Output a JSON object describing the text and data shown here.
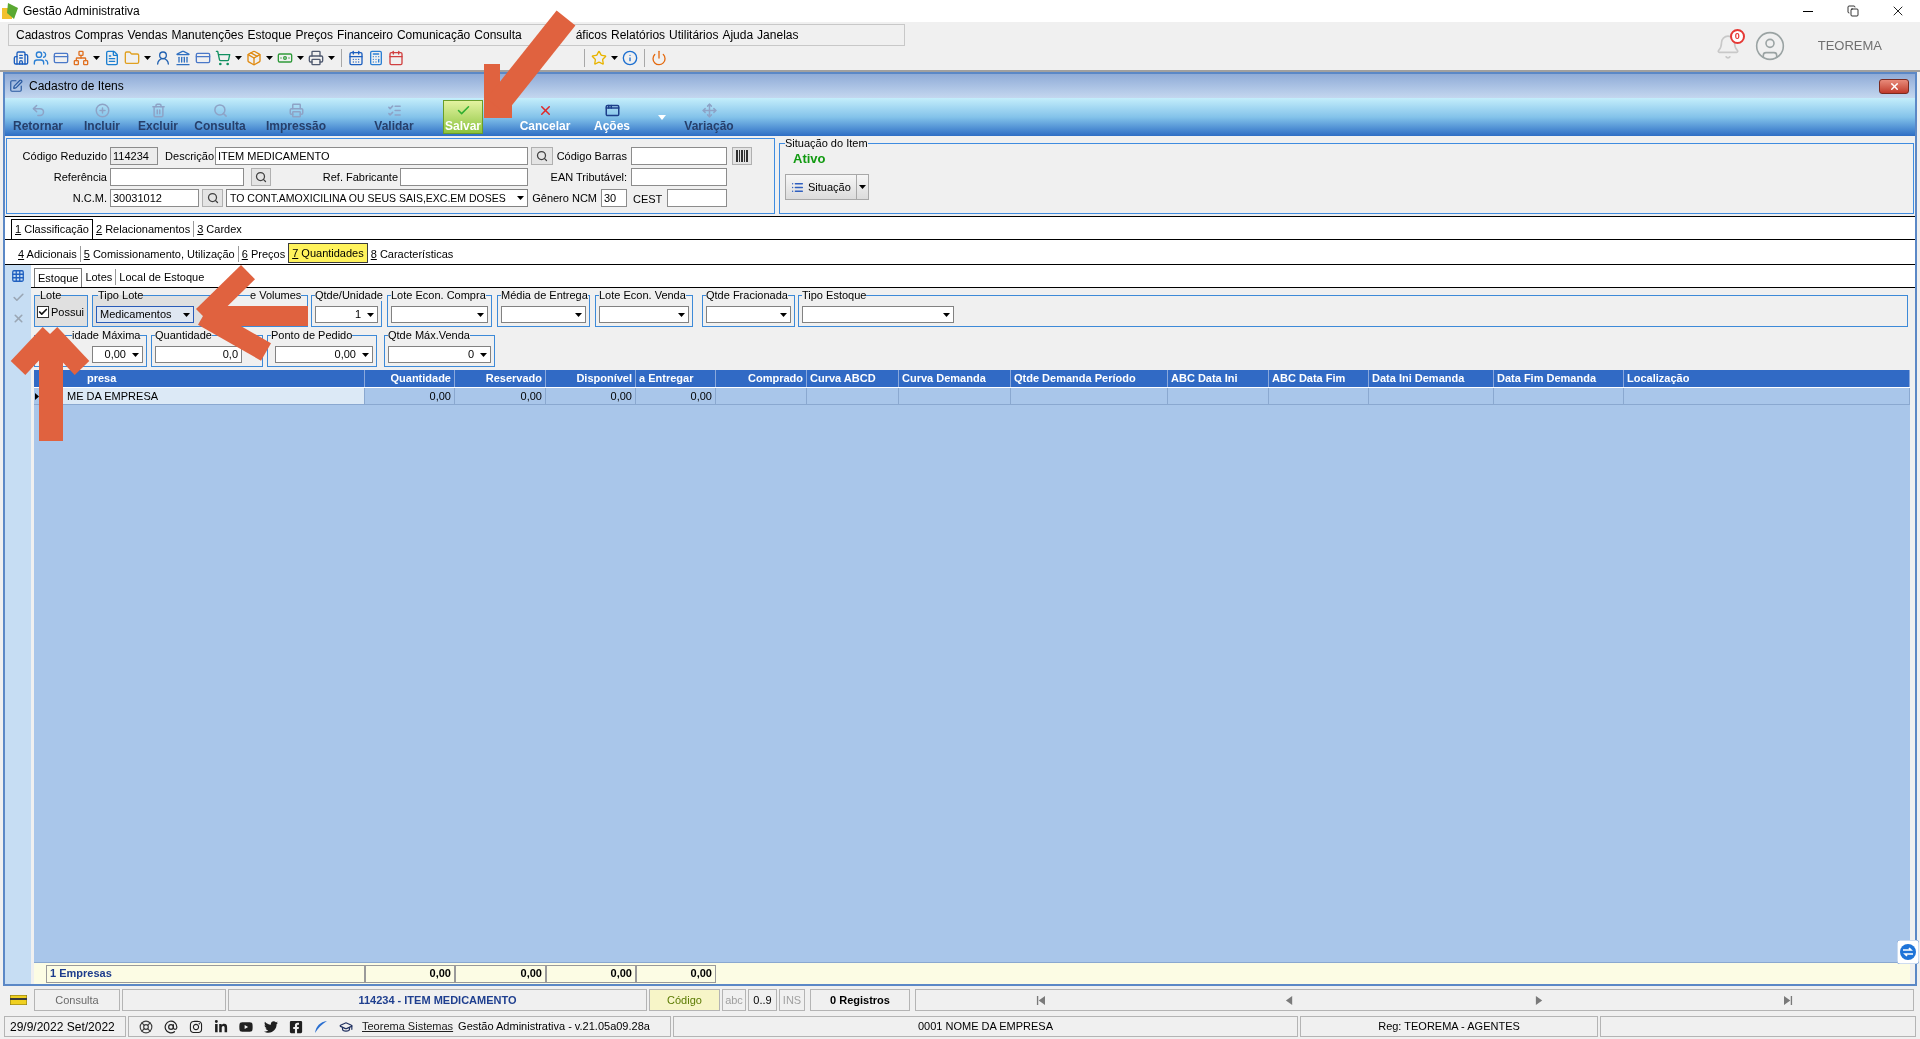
{
  "window": {
    "title": "Gestão Administrativa"
  },
  "menu": [
    "Cadastros",
    "Compras",
    "Vendas",
    "Manutenções",
    "Estoque",
    "Preços",
    "Financeiro",
    "Comunicação",
    "Consulta",
    "áficos",
    "Relatórios",
    "Utilitários",
    "Ajuda",
    "Janelas"
  ],
  "user_area": {
    "notifications": "0",
    "user_name": "TEOREMA"
  },
  "form_window": {
    "title": "Cadastro de Itens"
  },
  "actions": [
    {
      "label": "Retornar",
      "disabled": true,
      "highlighted": false,
      "dropdown": false
    },
    {
      "label": "Incluir",
      "disabled": true,
      "highlighted": false,
      "dropdown": false
    },
    {
      "label": "Excluir",
      "disabled": true,
      "highlighted": false,
      "dropdown": false
    },
    {
      "label": "Consulta",
      "disabled": true,
      "highlighted": false,
      "dropdown": false
    },
    {
      "label": "Impressão",
      "disabled": true,
      "highlighted": false,
      "dropdown": false
    },
    {
      "label": "Validar",
      "disabled": true,
      "highlighted": false,
      "dropdown": false
    },
    {
      "label": "Salvar",
      "disabled": false,
      "highlighted": true,
      "dropdown": false
    },
    {
      "label": "Cancelar",
      "disabled": false,
      "highlighted": false,
      "dropdown": false
    },
    {
      "label": "Ações",
      "disabled": false,
      "highlighted": false,
      "dropdown": true
    },
    {
      "label": "Variação",
      "disabled": true,
      "highlighted": false,
      "dropdown": false
    }
  ],
  "item_form": {
    "codigo_reduzido": {
      "label": "Código Reduzido",
      "value": "114234"
    },
    "descricao": {
      "label": "Descrição",
      "value": "ITEM MEDICAMENTO"
    },
    "codigo_barras": {
      "label": "Código Barras"
    },
    "referencia": {
      "label": "Referência"
    },
    "ref_fabricante": {
      "label": "Ref. Fabricante"
    },
    "ean_tributavel": {
      "label": "EAN Tributável:"
    },
    "ncm": {
      "label": "N.C.M.",
      "value": "30031012",
      "description": "TO CONT.AMOXICILINA OU SEUS SAIS,EXC.EM DOSES"
    },
    "genero_ncm": {
      "label": "Gênero NCM",
      "value": "30"
    },
    "cest": {
      "label": "CEST"
    }
  },
  "situacao": {
    "title": "Situação do Item",
    "status": "Ativo",
    "button": "Situação"
  },
  "tabs": [
    {
      "label": "1 Classificação",
      "selected": true
    },
    {
      "label": "2 Relacionamentos",
      "selected": false
    },
    {
      "label": "3 Cardex",
      "selected": false
    }
  ],
  "subtabs": [
    {
      "label": "4 Adicionais",
      "selected": false
    },
    {
      "label": "5 Comissionamento, Utilização",
      "selected": false
    },
    {
      "label": "6 Preços",
      "selected": false
    },
    {
      "label": "7 Quantidades",
      "selected": true
    },
    {
      "label": "8 Características",
      "selected": false
    }
  ],
  "stock_tabs": [
    {
      "label": "Estoque",
      "selected": true
    },
    {
      "label": "Lotes",
      "selected": false
    },
    {
      "label": "Local de Estoque",
      "selected": false
    }
  ],
  "fields_row_1": [
    {
      "kind": "checkbox",
      "label": "Lote",
      "option": "Possui",
      "checked": true
    },
    {
      "kind": "combo",
      "label": "Tipo Lote",
      "value": "Medicamentos",
      "focused": true
    },
    {
      "kind": "label",
      "label": "e Volumes"
    },
    {
      "kind": "combo",
      "label": "Qtde/Unidade",
      "value": "1",
      "focused": false
    },
    {
      "kind": "combo",
      "label": "Lote Econ. Compra",
      "focused": false
    },
    {
      "kind": "combo",
      "label": "Média de Entrega",
      "focused": false
    },
    {
      "kind": "combo",
      "label": "Lote Econ. Venda",
      "focused": false
    },
    {
      "kind": "combo",
      "label": "Qtde Fracionada",
      "focused": false
    },
    {
      "kind": "combo",
      "label": "Tipo Estoque",
      "focused": false
    }
  ],
  "fields_row_2": [
    {
      "kind": "combo",
      "label": "idade Máxima",
      "value": "0,00"
    },
    {
      "kind": "input",
      "label": "Quantidade",
      "value": "0,0"
    },
    {
      "kind": "combo",
      "label": "Ponto de Pedido",
      "value": "0,00"
    },
    {
      "kind": "combo",
      "label": "Qtde Máx.Venda",
      "value": "0"
    }
  ],
  "grid": {
    "columns": [
      "presa",
      "Quantidade",
      "Reservado",
      "Disponível",
      "a Entregar",
      "Comprado",
      "Curva ABCD",
      "Curva Demanda",
      "Qtde Demanda Período",
      "ABC Data Ini",
      "ABC Data Fim",
      "Data Ini Demanda",
      "Data Fim Demanda",
      "Localização"
    ],
    "rows": [
      {
        "selected": true,
        "cells": [
          "ME DA EMPRESA",
          "0,00",
          "0,00",
          "0,00",
          "0,00"
        ]
      }
    ],
    "totals": [
      "1 Empresas",
      "0,00",
      "0,00",
      "0,00",
      "0,00"
    ]
  },
  "status_bar": {
    "mode": "Consulta",
    "record": "114234 - ITEM MEDICAMENTO",
    "field": "Código",
    "indicators": [
      {
        "label": "abc",
        "on": false
      },
      {
        "label": "0..9",
        "on": true
      },
      {
        "label": "INS",
        "on": false
      }
    ],
    "records": "0 Registros"
  },
  "bottom_bar": {
    "date": "29/9/2022 Set/2022",
    "link": "Teorema Sistemas",
    "version": "Gestão Administrativa - v.21.05a09.28a",
    "company": "0001 NOME DA EMPRESA",
    "registration": "Reg: TEOREMA - AGENTES"
  }
}
